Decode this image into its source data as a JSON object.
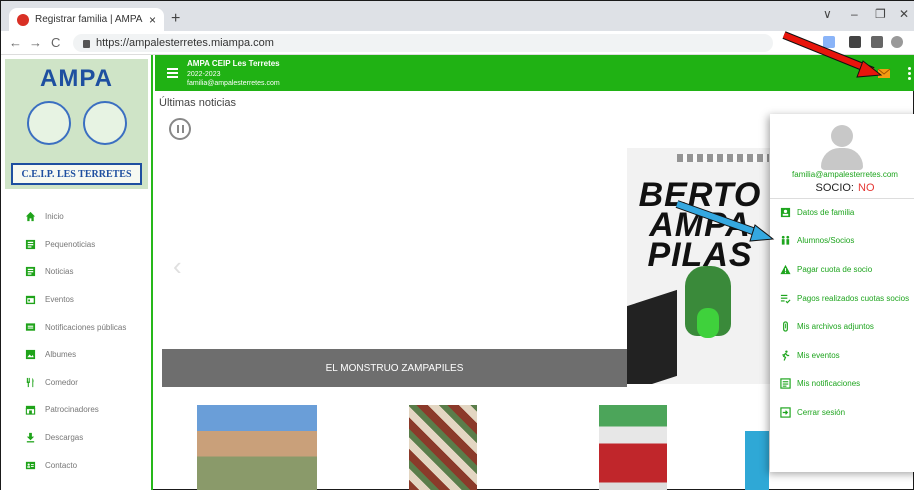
{
  "browser": {
    "tab_title": "Registrar familia | AMPA CEIP Les",
    "tab_close": "×",
    "new_tab": "+",
    "url": "https://ampalesterretes.miampa.com",
    "back": "←",
    "forward": "→",
    "reload": "C",
    "min": "‒",
    "max": "❐",
    "close": "✕",
    "expand": "∨"
  },
  "logo": {
    "title": "AMPA",
    "school": "C.E.I.P. LES TERRETES"
  },
  "sidebar": {
    "items": [
      {
        "label": "Inicio",
        "icon": "home-icon"
      },
      {
        "label": "Pequenoticias",
        "icon": "news-icon"
      },
      {
        "label": "Noticias",
        "icon": "news-icon"
      },
      {
        "label": "Eventos",
        "icon": "calendar-icon"
      },
      {
        "label": "Notificaciones públicas",
        "icon": "message-icon"
      },
      {
        "label": "Albumes",
        "icon": "image-icon"
      },
      {
        "label": "Comedor",
        "icon": "cutlery-icon"
      },
      {
        "label": "Patrocinadores",
        "icon": "store-icon"
      },
      {
        "label": "Descargas",
        "icon": "download-icon"
      },
      {
        "label": "Contacto",
        "icon": "contact-icon"
      }
    ]
  },
  "appbar": {
    "school": "AMPA CEIP Les Terretes",
    "year": "2022-2023",
    "email": "familia@ampalesterretes.com"
  },
  "main": {
    "section_title": "Últimas noticias",
    "carousel_caption": "EL MONSTRUO ZAMPAPILES",
    "poster_text": "BERTO AMPA PILAS"
  },
  "profile_menu": {
    "email": "familia@ampalesterretes.com",
    "socio_label": "SOCIO:",
    "socio_value": "NO",
    "items": [
      {
        "label": "Datos de familia",
        "icon": "family-icon"
      },
      {
        "label": "Alumnos/Socios",
        "icon": "people-icon"
      },
      {
        "label": "Pagar cuota de socio",
        "icon": "warning-icon"
      },
      {
        "label": "Pagos realizados cuotas socios",
        "icon": "list-check-icon"
      },
      {
        "label": "Mis archivos adjuntos",
        "icon": "paperclip-icon"
      },
      {
        "label": "Mis eventos",
        "icon": "running-icon"
      },
      {
        "label": "Mis notificaciones",
        "icon": "notifications-icon"
      },
      {
        "label": "Cerrar sesión",
        "icon": "logout-icon"
      }
    ]
  },
  "colors": {
    "brand_green": "#20b214",
    "link_green": "#1ea51e",
    "no_red": "#e53935",
    "annotation_red": "#e8150c",
    "annotation_blue": "#35a8e0"
  }
}
